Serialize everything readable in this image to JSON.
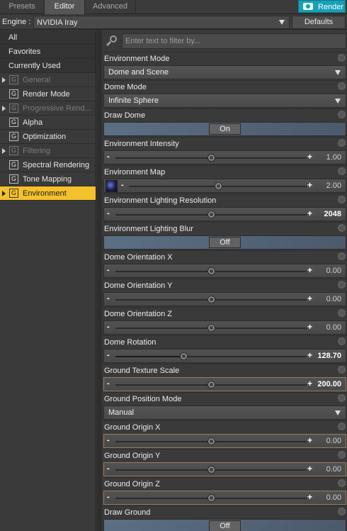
{
  "tabs": [
    {
      "label": "Presets",
      "active": false
    },
    {
      "label": "Editor",
      "active": true
    },
    {
      "label": "Advanced",
      "active": false
    }
  ],
  "render_button": "Render",
  "engine": {
    "label": "Engine :",
    "value": "NVIDIA Iray",
    "defaults_label": "Defaults"
  },
  "sidebar": {
    "items": [
      {
        "label": "All",
        "kind": "plain"
      },
      {
        "label": "Favorites",
        "kind": "plain"
      },
      {
        "label": "Currently Used",
        "kind": "plain"
      },
      {
        "label": "General",
        "kind": "group",
        "expandable": true,
        "dim": true
      },
      {
        "label": "Render Mode",
        "kind": "group",
        "expandable": false,
        "dim": false
      },
      {
        "label": "Progressive Rend...",
        "kind": "group",
        "expandable": true,
        "dim": true
      },
      {
        "label": "Alpha",
        "kind": "group",
        "expandable": false,
        "dim": false
      },
      {
        "label": "Optimization",
        "kind": "group",
        "expandable": false,
        "dim": false
      },
      {
        "label": "Filtering",
        "kind": "group",
        "expandable": true,
        "dim": true
      },
      {
        "label": "Spectral Rendering",
        "kind": "group",
        "expandable": false,
        "dim": false
      },
      {
        "label": "Tone Mapping",
        "kind": "group",
        "expandable": false,
        "dim": false
      },
      {
        "label": "Environment",
        "kind": "group",
        "expandable": true,
        "dim": false,
        "selected": true
      }
    ],
    "group_glyph": "G"
  },
  "filter": {
    "placeholder": "Enter text to filter by..."
  },
  "properties": [
    {
      "label": "Environment Mode",
      "type": "dropdown",
      "value": "Dome and Scene"
    },
    {
      "label": "Dome Mode",
      "type": "dropdown",
      "value": "Infinite Sphere"
    },
    {
      "label": "Draw Dome",
      "type": "toggle",
      "value": "On"
    },
    {
      "label": "Environment Intensity",
      "type": "slider",
      "value": "1.00",
      "position": 0.5
    },
    {
      "label": "Environment Map",
      "type": "slider",
      "value": "2.00",
      "position": 0.5,
      "map": true
    },
    {
      "label": "Environment Lighting Resolution",
      "type": "slider",
      "value": "2048",
      "position": 0.5,
      "bold": true
    },
    {
      "label": "Environment Lighting Blur",
      "type": "toggle",
      "value": "Off"
    },
    {
      "label": "Dome Orientation X",
      "type": "slider",
      "value": "0.00",
      "position": 0.5
    },
    {
      "label": "Dome Orientation Y",
      "type": "slider",
      "value": "0.00",
      "position": 0.5
    },
    {
      "label": "Dome Orientation Z",
      "type": "slider",
      "value": "0.00",
      "position": 0.5
    },
    {
      "label": "Dome Rotation",
      "type": "slider",
      "value": "128.70",
      "position": 0.357,
      "bold": true,
      "filled": true
    },
    {
      "label": "Ground Texture Scale",
      "type": "slider",
      "value": "200.00",
      "position": 0.5,
      "bold": true,
      "highlight": true
    },
    {
      "label": "Ground Position Mode",
      "type": "dropdown",
      "value": "Manual"
    },
    {
      "label": "Ground Origin X",
      "type": "slider",
      "value": "0.00",
      "position": 0.5,
      "highlight": true
    },
    {
      "label": "Ground Origin Y",
      "type": "slider",
      "value": "0.00",
      "position": 0.5,
      "highlight": true
    },
    {
      "label": "Ground Origin Z",
      "type": "slider",
      "value": "0.00",
      "position": 0.5,
      "highlight": true
    },
    {
      "label": "Draw Ground",
      "type": "toggle",
      "value": "Off"
    }
  ]
}
